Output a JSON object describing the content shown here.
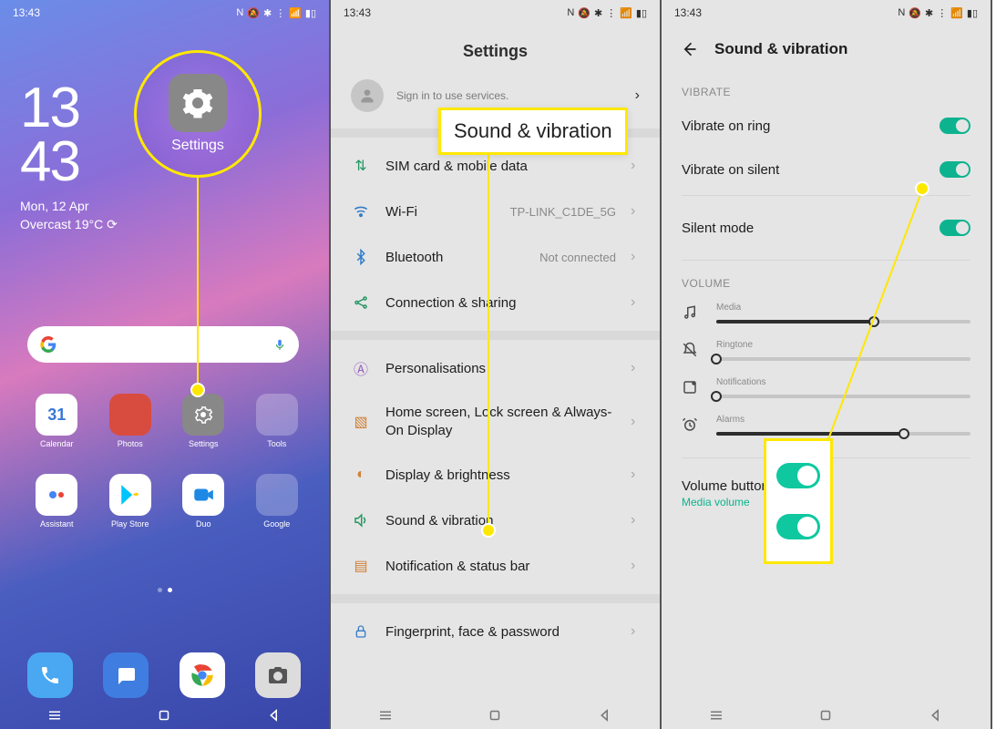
{
  "status": {
    "time": "13:43"
  },
  "home": {
    "hh": "13",
    "mm": "43",
    "date": "Mon, 12 Apr",
    "weather": "Overcast 19°C",
    "settings_label": "Settings",
    "apps": [
      {
        "label": "Calendar",
        "bg": "#ffffff"
      },
      {
        "label": "Photos",
        "bg": "#d84c3f"
      },
      {
        "label": "Settings",
        "bg": "#888888"
      },
      {
        "label": "Tools",
        "bg": "#6a6a6a"
      },
      {
        "label": "Assistant",
        "bg": "#ffffff"
      },
      {
        "label": "Play Store",
        "bg": "#ffffff"
      },
      {
        "label": "Duo",
        "bg": "#ffffff"
      },
      {
        "label": "Google",
        "bg": "#ffffff"
      }
    ],
    "dock": [
      {
        "name": "phone",
        "bg": "#4aa8f2"
      },
      {
        "name": "messages",
        "bg": "#3f7de0"
      },
      {
        "name": "chrome",
        "bg": "#ffffff"
      },
      {
        "name": "camera",
        "bg": "#dcdcdc"
      }
    ]
  },
  "settings": {
    "title": "Settings",
    "profile_sub": "Sign in to use services.",
    "callout": "Sound & vibration",
    "items": [
      {
        "label": "SIM card & mobile data",
        "value": "",
        "icon": "sim"
      },
      {
        "label": "Wi-Fi",
        "value": "TP-LINK_C1DE_5G",
        "icon": "wifi"
      },
      {
        "label": "Bluetooth",
        "value": "Not connected",
        "icon": "bt"
      },
      {
        "label": "Connection & sharing",
        "value": "",
        "icon": "share"
      }
    ],
    "items2": [
      {
        "label": "Personalisations",
        "value": "",
        "icon": "palette"
      },
      {
        "label": "Home screen, Lock screen & Always-On Display",
        "value": "",
        "icon": "home"
      },
      {
        "label": "Display & brightness",
        "value": "",
        "icon": "bright"
      },
      {
        "label": "Sound & vibration",
        "value": "",
        "icon": "sound"
      },
      {
        "label": "Notification & status bar",
        "value": "",
        "icon": "notif"
      }
    ],
    "items3": [
      {
        "label": "Fingerprint, face & password",
        "value": "",
        "icon": "lock"
      }
    ]
  },
  "sound": {
    "title": "Sound & vibration",
    "vibrate_header": "VIBRATE",
    "vibrate_ring": "Vibrate on ring",
    "vibrate_silent": "Vibrate on silent",
    "silent_mode": "Silent mode",
    "volume_header": "VOLUME",
    "sliders": [
      {
        "label": "Media",
        "pos": 62
      },
      {
        "label": "Ringtone",
        "pos": 0
      },
      {
        "label": "Notifications",
        "pos": 0
      },
      {
        "label": "Alarms",
        "pos": 74
      }
    ],
    "vbf_title": "Volume button function",
    "vbf_sub": "Media volume"
  }
}
